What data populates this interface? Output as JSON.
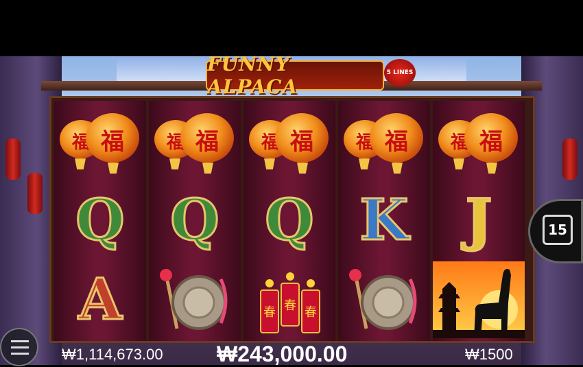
{
  "game": {
    "title": "FUNNY ALPACA",
    "lines_badge": "5 LINES",
    "free_spins_count": "15"
  },
  "reels": [
    [
      "lantern",
      "Q",
      "A"
    ],
    [
      "lantern",
      "Q",
      "gong"
    ],
    [
      "lantern",
      "Q",
      "firecrackers"
    ],
    [
      "lantern",
      "K",
      "gong"
    ],
    [
      "lantern",
      "J",
      "alpaca"
    ]
  ],
  "symbols": {
    "lantern_glyph": "福",
    "firecracker_glyph": "春"
  },
  "colors": {
    "Q": "#3f8a3a",
    "K": "#3a78c8",
    "J": "#e9c43a",
    "A": "#c0402c"
  },
  "footer": {
    "balance": "₩1,114,673.00",
    "win": "₩243,000.00",
    "bet": "₩1500"
  }
}
